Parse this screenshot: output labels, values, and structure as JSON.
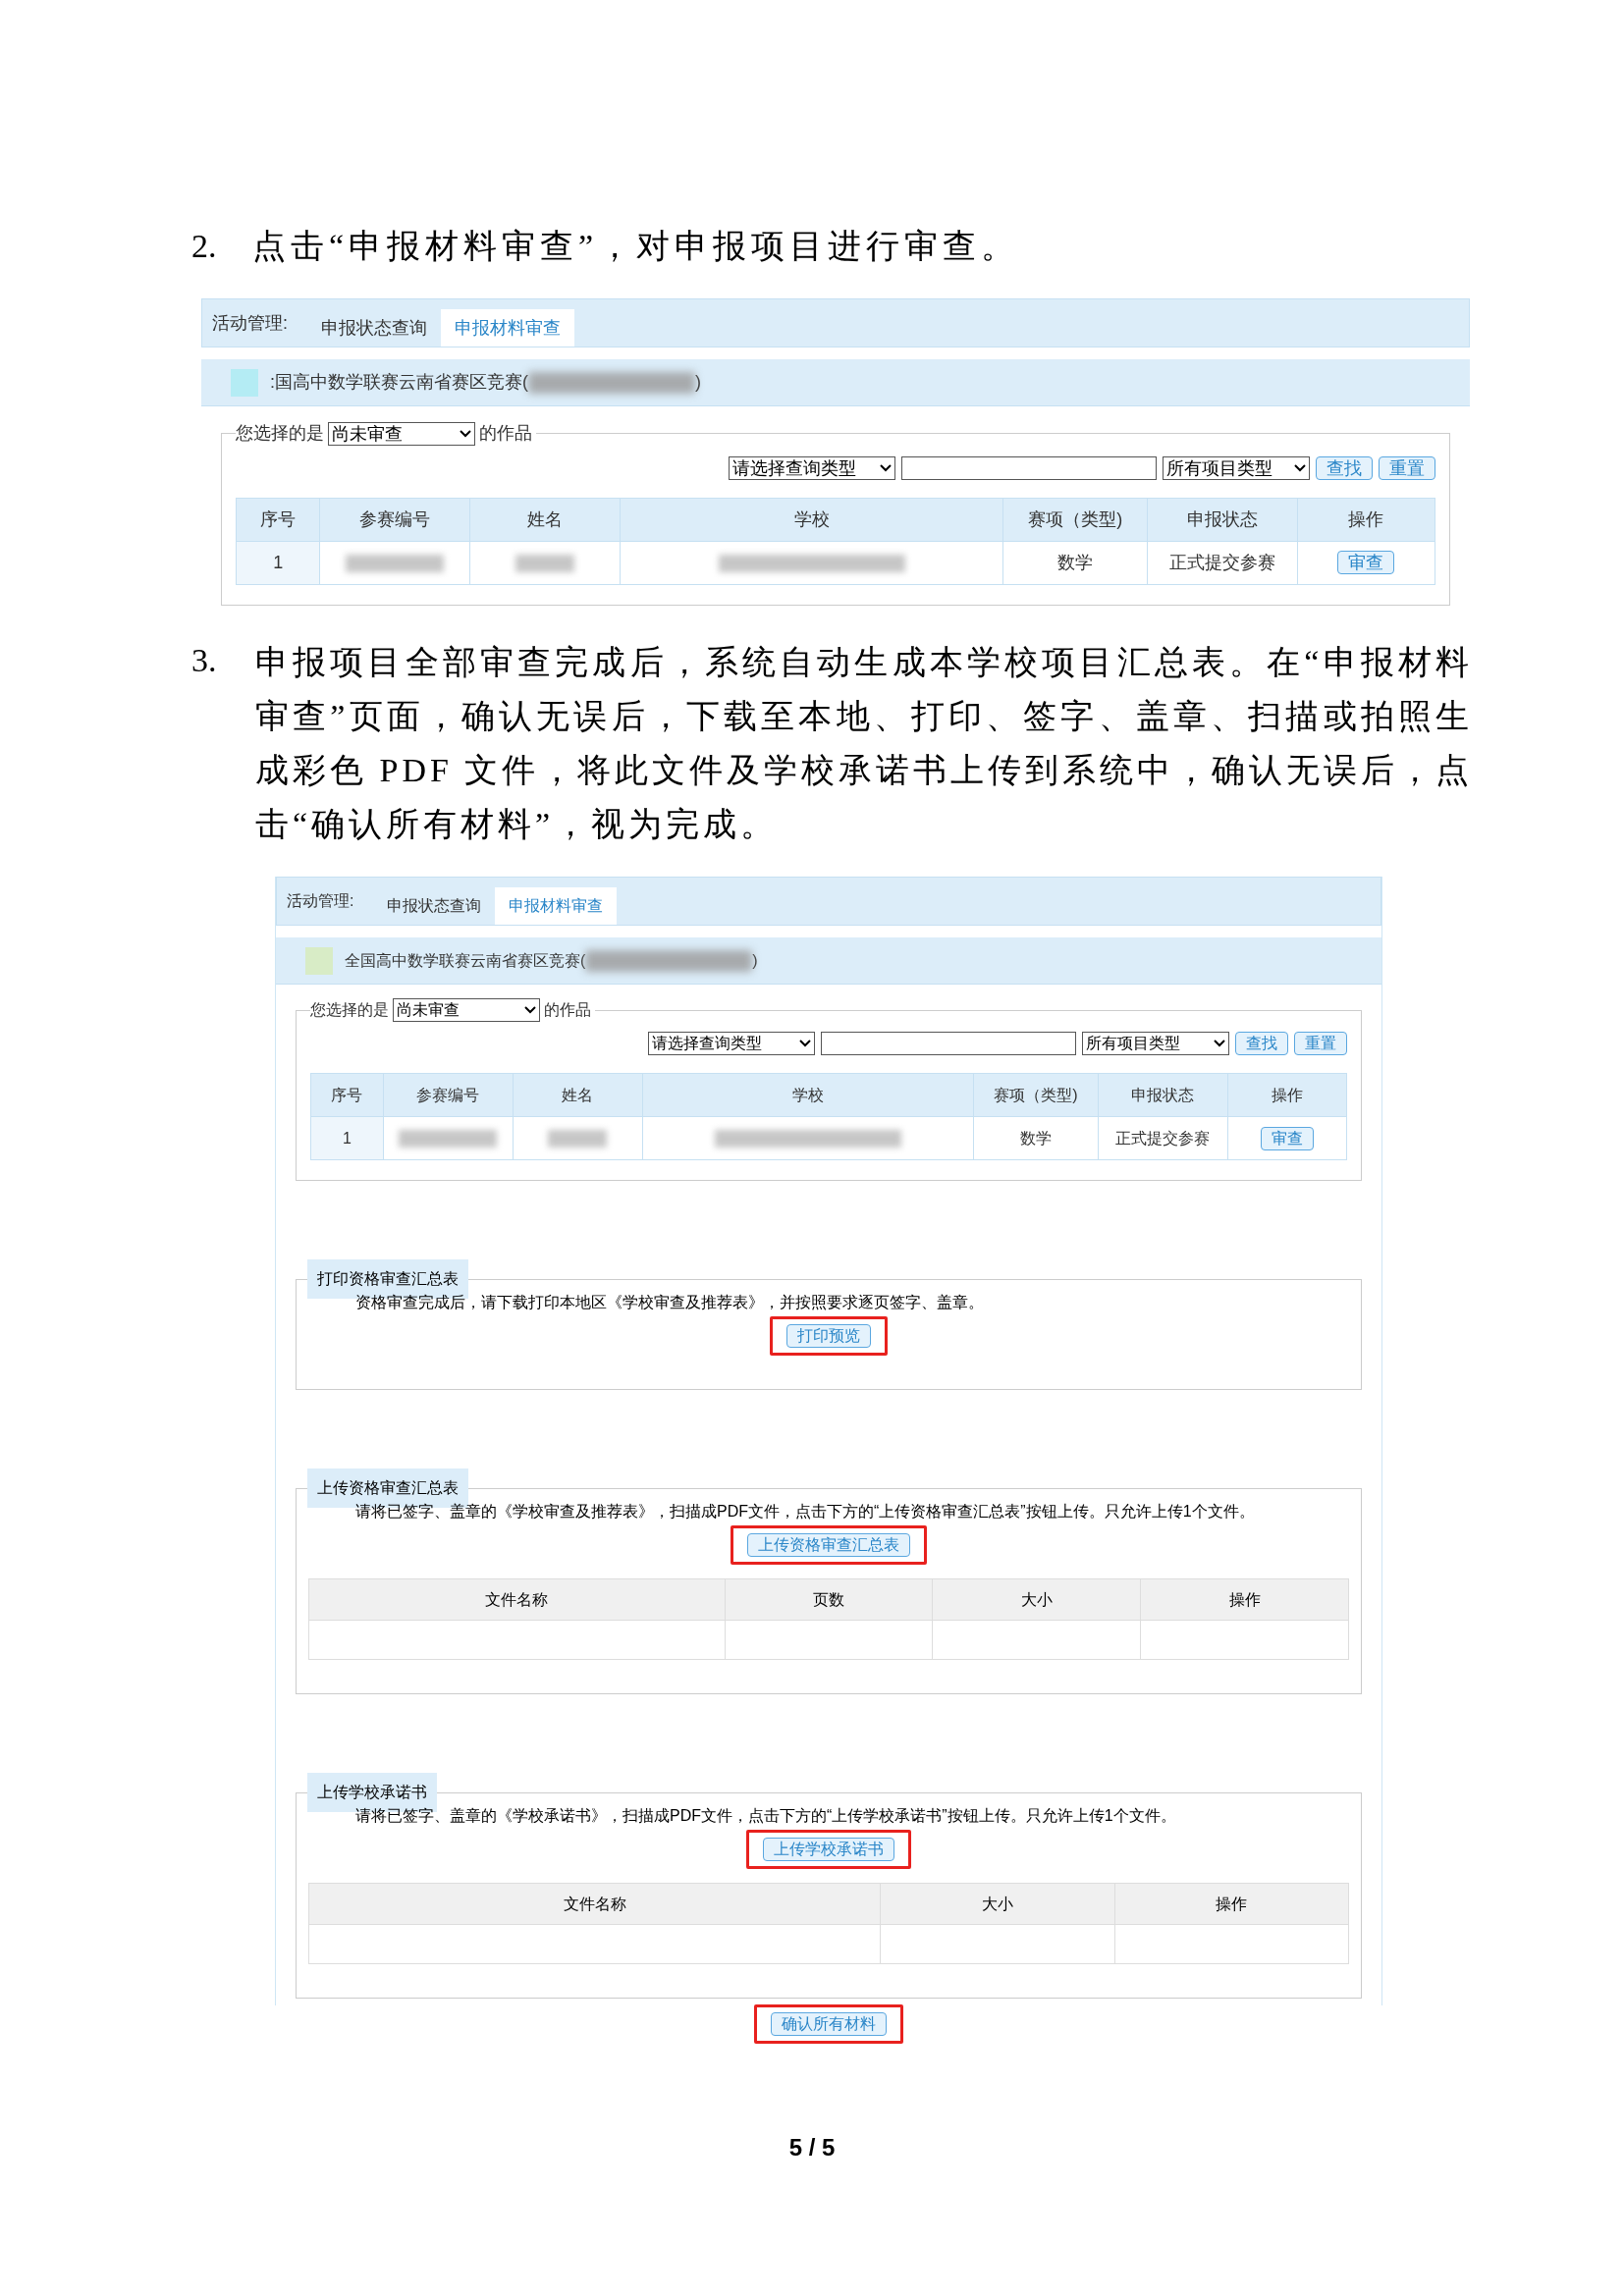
{
  "step2": {
    "number": "2.",
    "text": "点击“申报材料审查”，对申报项目进行审查。"
  },
  "screen1": {
    "nav_label": "活动管理:",
    "tabs": [
      {
        "label": "申报状态查询",
        "selected": false
      },
      {
        "label": "申报材料审查",
        "selected": true
      }
    ],
    "contest_title": ":国高中数学联赛云南省赛区竞赛(",
    "contest_title_end": ")",
    "filter": {
      "prefix": "您选择的是",
      "status_select": "尚未审查",
      "suffix": "的作品",
      "query_type_select": "请选择查询类型",
      "project_type_select": "所有项目类型",
      "buttons": [
        "查找",
        "重置"
      ]
    },
    "table": {
      "columns": [
        "序号",
        "参赛编号",
        "姓名",
        "学校",
        "赛项（类型)",
        "申报状态",
        "操作"
      ],
      "rows": [
        {
          "index": "1",
          "event": "数学",
          "status": "正式提交参赛",
          "action": "审查"
        }
      ]
    }
  },
  "step3": {
    "number": "3.",
    "text": "申报项目全部审查完成后，系统自动生成本学校项目汇总表。在“申报材料审查”页面，确认无误后，下载至本地、打印、签字、盖章、扫描或拍照生成彩色 PDF 文件，将此文件及学校承诺书上传到系统中，确认无误后，点击“确认所有材料”，视为完成。"
  },
  "screen2": {
    "nav_label": "活动管理:",
    "tabs": [
      {
        "label": "申报状态查询",
        "selected": false
      },
      {
        "label": "申报材料审查",
        "selected": true
      }
    ],
    "contest_title": "全国高中数学联赛云南省赛区竞赛(",
    "contest_title_end": ")",
    "filter": {
      "prefix": "您选择的是",
      "status_select": "尚未审查",
      "suffix": "的作品",
      "query_type_select": "请选择查询类型",
      "project_type_select": "所有项目类型",
      "buttons": [
        "查找",
        "重置"
      ]
    },
    "table": {
      "columns": [
        "序号",
        "参赛编号",
        "姓名",
        "学校",
        "赛项（类型)",
        "申报状态",
        "操作"
      ],
      "rows": [
        {
          "index": "1",
          "event": "数学",
          "status": "正式提交参赛",
          "action": "审查"
        }
      ]
    },
    "sections": [
      {
        "title": "打印资格审查汇总表",
        "text": "资格审查完成后，请下载打印本地区《学校审查及推荐表》，并按照要求逐页签字、盖章。",
        "button": "打印预览",
        "highlighted": true
      },
      {
        "title": "上传资格审查汇总表",
        "text": "请将已签字、盖章的《学校审查及推荐表》，扫描成PDF文件，点击下方的“上传资格审查汇总表”按钮上传。只允许上传1个文件。",
        "button": "上传资格审查汇总表",
        "highlighted": true,
        "file_columns": [
          "文件名称",
          "页数",
          "大小",
          "操作"
        ]
      },
      {
        "title": "上传学校承诺书",
        "text": "请将已签字、盖章的《学校承诺书》，扫描成PDF文件，点击下方的“上传学校承诺书”按钮上传。只允许上传1个文件。",
        "button": "上传学校承诺书",
        "highlighted": true,
        "file_columns": [
          "文件名称",
          "大小",
          "操作"
        ]
      }
    ],
    "confirm_button": {
      "label": "确认所有材料",
      "highlighted": true
    }
  },
  "page_number": "5 / 5"
}
